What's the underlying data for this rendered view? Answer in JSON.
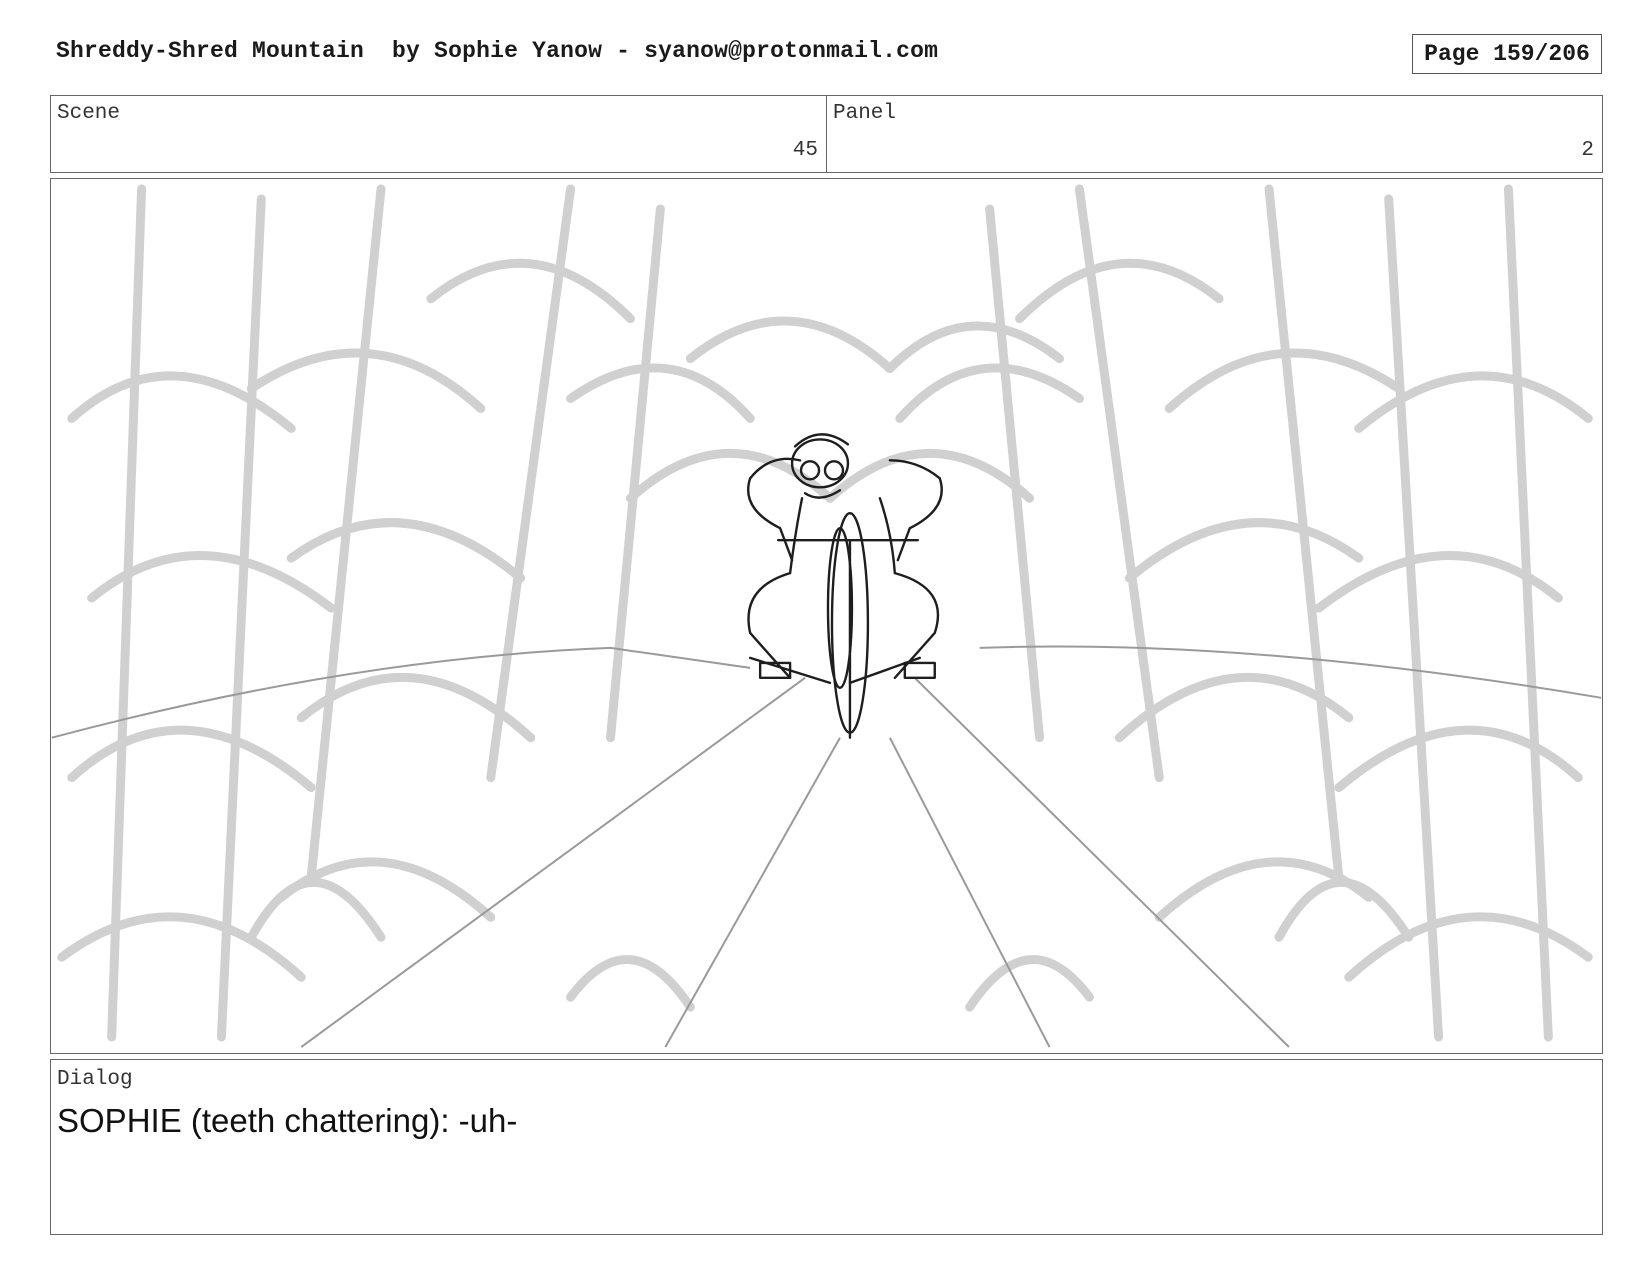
{
  "header": {
    "title": "Shreddy-Shred Mountain  by Sophie Yanow - syanow@protonmail.com",
    "page": "Page 159/206"
  },
  "info": {
    "scene_label": "Scene",
    "scene_value": "45",
    "panel_label": "Panel",
    "panel_value": "2"
  },
  "panel": {
    "drawing": "storyboard-sketch"
  },
  "dialog": {
    "label": "Dialog",
    "text": "SOPHIE (teeth chattering): -uh-"
  }
}
